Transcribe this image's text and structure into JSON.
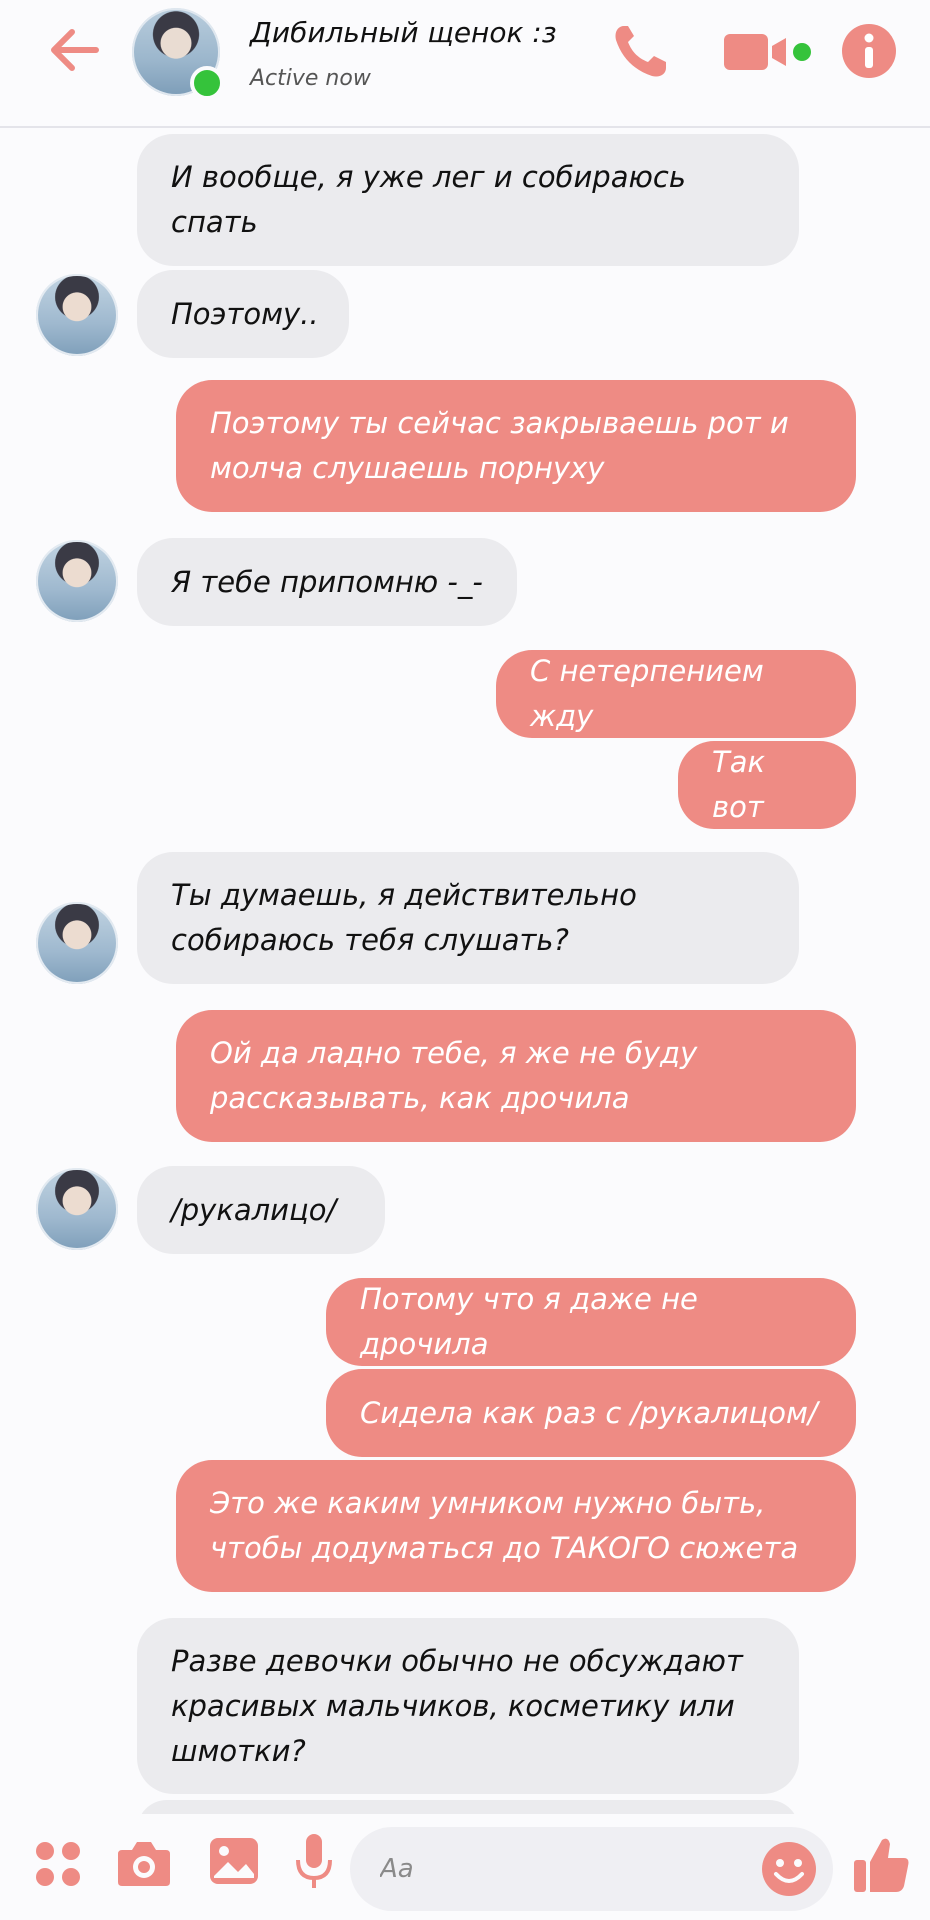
{
  "header": {
    "contact_name": "Дибильный щенок :з",
    "status": "Active now"
  },
  "messages": [
    {
      "dir": "in",
      "text": "И вообще, я уже лег и собираюсь спать"
    },
    {
      "dir": "in",
      "text": "Поэтому.."
    },
    {
      "dir": "out",
      "text": "Поэтому ты сейчас закрываешь рот и молча слушаешь порнуху"
    },
    {
      "dir": "in",
      "text": "Я тебе припомню -_-"
    },
    {
      "dir": "out",
      "text": "С нетерпением жду"
    },
    {
      "dir": "out",
      "text": "Так вот"
    },
    {
      "dir": "in",
      "text": "Ты думаешь, я действительно собираюсь тебя слушать?"
    },
    {
      "dir": "out",
      "text": "Ой да ладно тебе, я же не буду рассказывать, как дрочила"
    },
    {
      "dir": "in",
      "text": "/рукалицо/"
    },
    {
      "dir": "out",
      "text": "Потому что я даже не дрочила"
    },
    {
      "dir": "out",
      "text": "Сидела как раз с /рукалицом/"
    },
    {
      "dir": "out",
      "text": "Это же каким умником нужно быть, чтобы додуматься до ТАКОГО сюжета"
    },
    {
      "dir": "in",
      "text": "Разве девочки обычно не обсуждают красивых мальчиков, косметику или шмотки?"
    }
  ],
  "composer": {
    "placeholder": "Aa"
  },
  "colors": {
    "accent": "#ee8b84",
    "incoming_bubble": "#ebebee",
    "online": "#35c33b"
  },
  "icons": {
    "back": "back-arrow-icon",
    "call": "phone-icon",
    "video": "video-camera-icon",
    "info": "info-icon",
    "menu": "apps-icon",
    "camera": "camera-icon",
    "gallery": "image-icon",
    "mic": "microphone-icon",
    "emoji": "emoji-icon",
    "like": "thumbs-up-icon"
  }
}
